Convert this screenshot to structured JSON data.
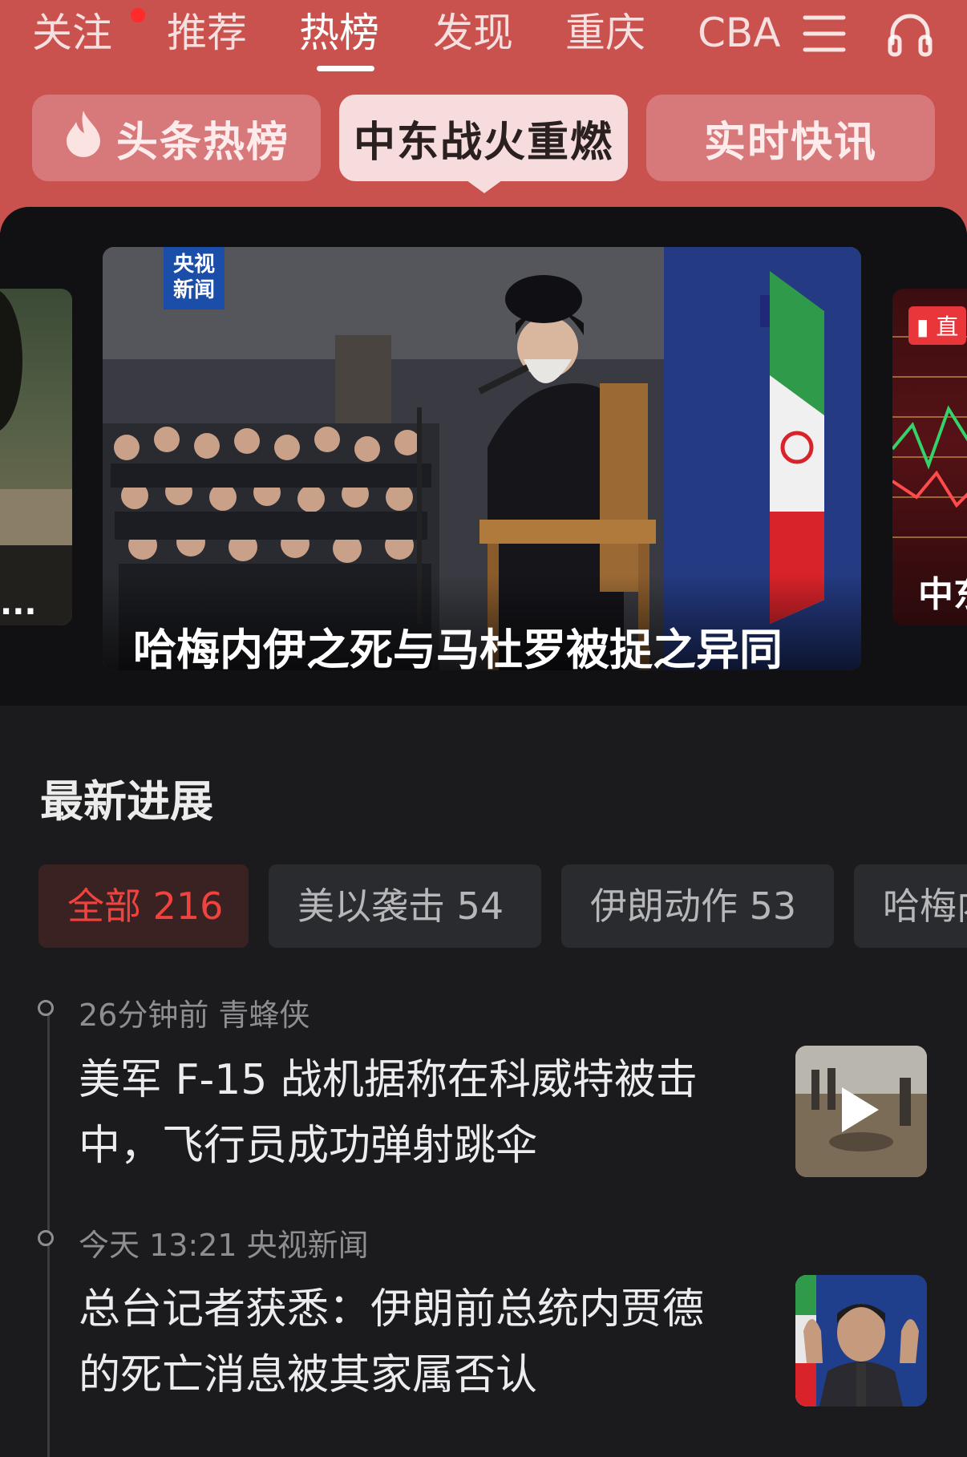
{
  "nav": {
    "tabs": [
      {
        "label": "关注"
      },
      {
        "label": "推荐"
      },
      {
        "label": "热榜"
      },
      {
        "label": "发现"
      },
      {
        "label": "重庆"
      },
      {
        "label": "CBA"
      }
    ],
    "active_tab": "热榜",
    "icons": [
      "menu-icon",
      "headphones-icon"
    ]
  },
  "sub_tabs": [
    {
      "label": "头条热榜",
      "icon": "flame-icon"
    },
    {
      "label": "中东战火重燃"
    },
    {
      "label": "实时快讯"
    }
  ],
  "carousel": {
    "main_caption": "哈梅内伊之死与马杜罗被捉之异同",
    "main_logo": "央视新闻",
    "right_badge": "直",
    "right_caption": "中东",
    "left_caption": "..."
  },
  "latest": {
    "title": "最新进展",
    "filters": [
      {
        "label": "全部 216"
      },
      {
        "label": "美以袭击 54"
      },
      {
        "label": "伊朗动作 53"
      },
      {
        "label": "哈梅内"
      }
    ],
    "news": [
      {
        "meta": "26分钟前 青蜂侠",
        "title": "美军 F-15 战机据称在科威特被击中，飞行员成功弹射跳伞",
        "thumb": "video"
      },
      {
        "meta": "今天 13:21 央视新闻",
        "title": "总台记者获悉：伊朗前总统内贾德的死亡消息被其家属否认",
        "thumb": "photo"
      }
    ]
  },
  "colors": {
    "header_red": "#c9514e",
    "accent_red": "#f0433f",
    "background": "#1b1b1d"
  }
}
